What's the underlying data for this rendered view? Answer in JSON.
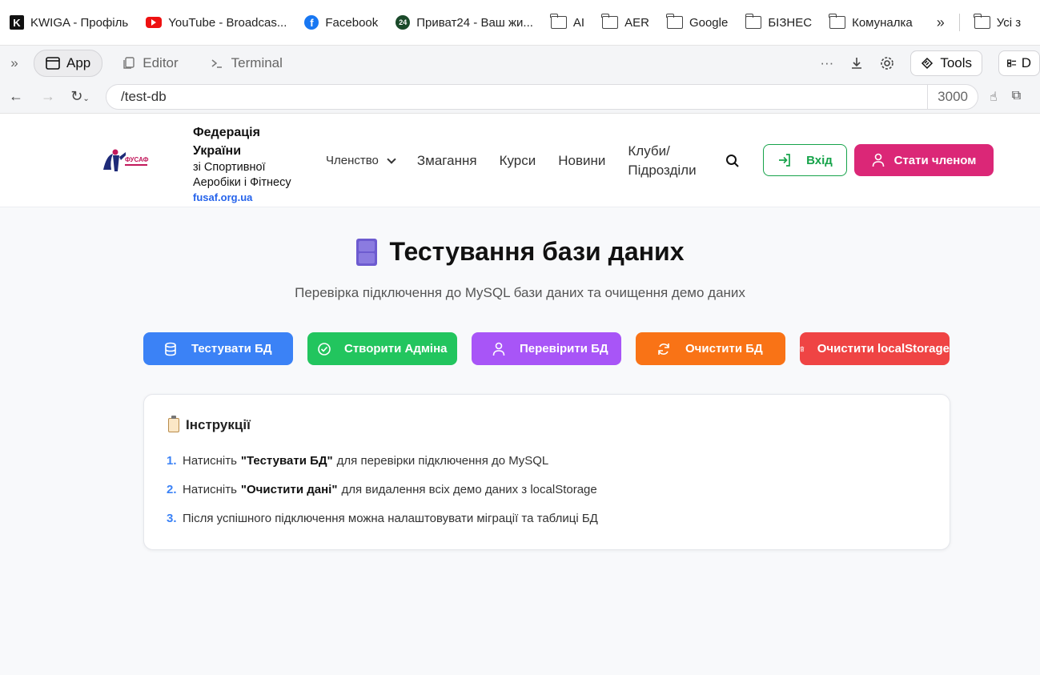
{
  "bookmarks": {
    "items": [
      {
        "label": "KWIGA - Профіль",
        "icon": "kwiga-icon"
      },
      {
        "label": "YouTube - Broadcas...",
        "icon": "youtube-icon"
      },
      {
        "label": "Facebook",
        "icon": "facebook-icon"
      },
      {
        "label": "Приват24 - Ваш жи...",
        "icon": "privat24-icon"
      },
      {
        "label": "AI",
        "icon": "folder-icon"
      },
      {
        "label": "AER",
        "icon": "folder-icon"
      },
      {
        "label": "Google",
        "icon": "folder-icon"
      },
      {
        "label": "БІЗНЕС",
        "icon": "folder-icon"
      },
      {
        "label": "Комуналка",
        "icon": "folder-icon"
      }
    ],
    "all_label": "Усі з",
    "more": "»"
  },
  "toolbar": {
    "tabs": [
      {
        "label": "App",
        "active": true
      },
      {
        "label": "Editor",
        "active": false
      },
      {
        "label": "Terminal",
        "active": false
      }
    ],
    "more": "···",
    "tools_label": "Tools",
    "d_label": "D"
  },
  "urlbar": {
    "url": "/test-db",
    "port": "3000"
  },
  "site": {
    "brand_line1": "Федерація",
    "brand_line2": "України",
    "brand_line3": "зі Спортивної",
    "brand_line4": "Аеробіки і Фітнесу",
    "brand_domain": "fusaf.org.ua",
    "logo_text": "ФУСАФ",
    "nav": {
      "membership": "Членство",
      "competitions": "Змагання",
      "courses": "Курси",
      "news": "Новини",
      "clubs_line1": "Клуби/",
      "clubs_line2": "Підрозділи"
    },
    "login_label": "Вхід",
    "become_member_label": "Стати членом"
  },
  "main": {
    "title": "Тестування бази даних",
    "subtitle": "Перевірка підключення до MySQL бази даних та очищення демо даних",
    "buttons": {
      "test_db": "Тестувати БД",
      "create_admin": "Створити Адміна",
      "check_db": "Перевірити БД",
      "clear_db": "Очистити БД",
      "clear_local": "Очистити localStorage"
    },
    "colors": {
      "blue": "#3b82f6",
      "green": "#22c55e",
      "purple": "#a855f7",
      "orange": "#f97316",
      "red": "#ef4444",
      "pink": "#db2777"
    },
    "instructions": {
      "title": "Інструкції",
      "steps": [
        {
          "num": "1.",
          "pre": "Натисніть",
          "bold": "\"Тестувати БД\"",
          "post": "для перевірки підключення до MySQL"
        },
        {
          "num": "2.",
          "pre": "Натисніть",
          "bold": "\"Очистити дані\"",
          "post": "для видалення всіх демо даних з localStorage"
        },
        {
          "num": "3.",
          "pre": "Після успішного підключення можна налаштовувати міграції та таблиці БД",
          "bold": "",
          "post": ""
        }
      ]
    }
  }
}
